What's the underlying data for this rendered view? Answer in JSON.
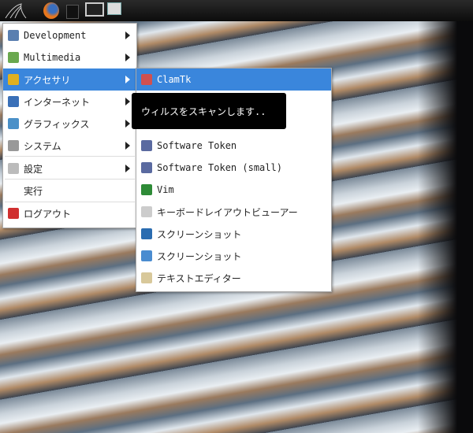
{
  "menu": {
    "items": [
      {
        "label": "Development",
        "icon": "development-icon",
        "color": "#5a7fb0",
        "submenu": true
      },
      {
        "label": "Multimedia",
        "icon": "multimedia-icon",
        "color": "#6aa84f",
        "submenu": true
      },
      {
        "label": "アクセサリ",
        "icon": "accessories-icon",
        "color": "#e0b020",
        "submenu": true
      },
      {
        "label": "インターネット",
        "icon": "internet-icon",
        "color": "#3a70b8",
        "submenu": true
      },
      {
        "label": "グラフィックス",
        "icon": "graphics-icon",
        "color": "#4a90c8",
        "submenu": true
      },
      {
        "label": "システム",
        "icon": "system-icon",
        "color": "#999999",
        "submenu": true
      },
      {
        "label": "設定",
        "icon": "settings-icon",
        "color": "#bbbbbb",
        "submenu": true
      },
      {
        "label": "実行",
        "icon": "",
        "color": "",
        "submenu": false
      },
      {
        "label": "ログアウト",
        "icon": "logout-icon",
        "color": "#d03030",
        "submenu": false
      }
    ]
  },
  "submenu": {
    "items": [
      {
        "label": "ClamTk",
        "icon": "clamtk-icon",
        "color": "#d05050"
      },
      {
        "label": "Software Token",
        "icon": "token-icon",
        "color": "#5a6aa0"
      },
      {
        "label": "Software Token (small)",
        "icon": "token-icon",
        "color": "#5a6aa0"
      },
      {
        "label": "Vim",
        "icon": "vim-icon",
        "color": "#2e8b37"
      },
      {
        "label": "キーボードレイアウトビューアー",
        "icon": "keyboard-icon",
        "color": "#cccccc"
      },
      {
        "label": "スクリーンショット",
        "icon": "screenshot-icon",
        "color": "#2a6cb0"
      },
      {
        "label": "スクリーンショット",
        "icon": "screenshot-icon",
        "color": "#4a8cd0"
      },
      {
        "label": "テキストエディター",
        "icon": "text-editor-icon",
        "color": "#d8c89a"
      }
    ]
  },
  "tooltip": "ウィルスをスキャンします..",
  "accent": "#3a86dc"
}
